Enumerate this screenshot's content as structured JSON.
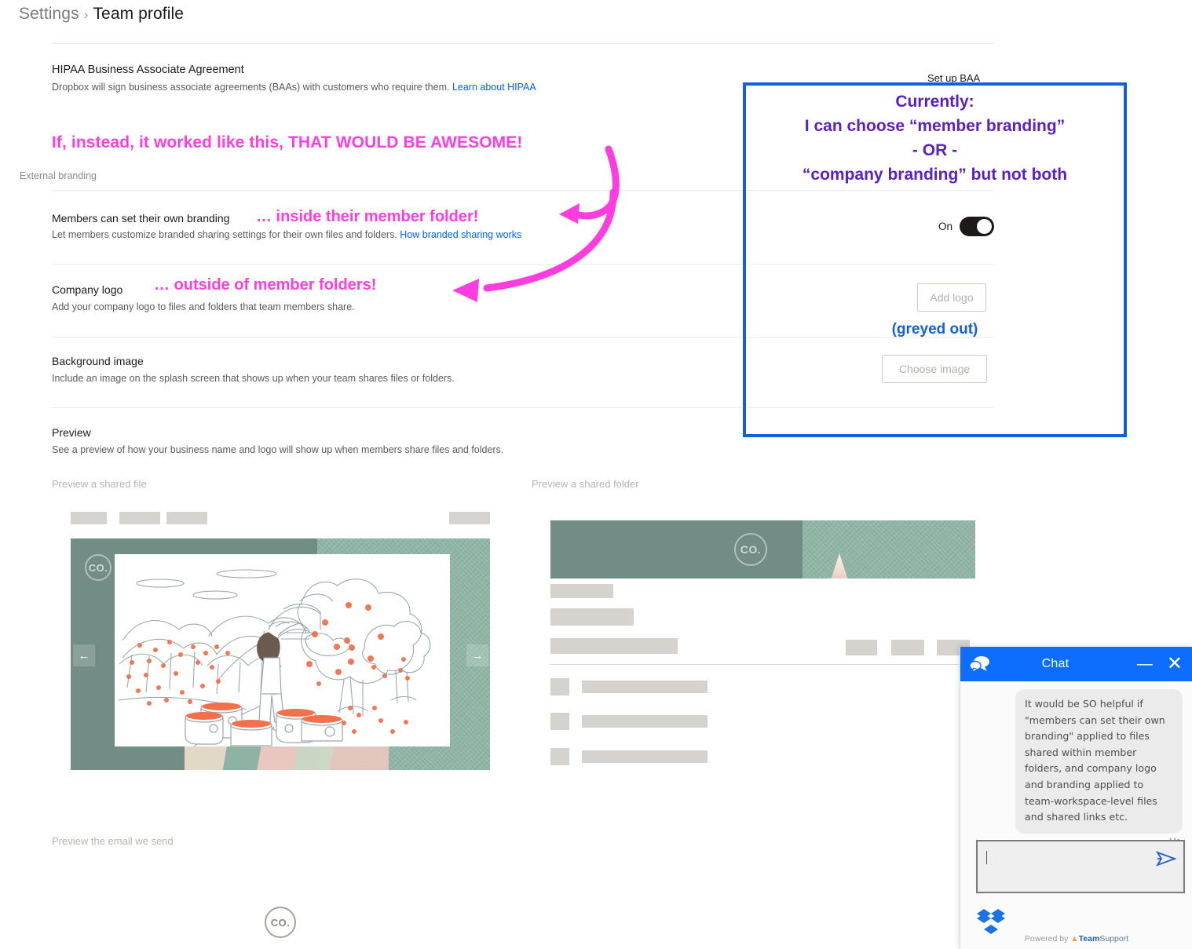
{
  "breadcrumb": {
    "parent": "Settings",
    "separator": "›",
    "current": "Team profile"
  },
  "hipaa": {
    "title": "HIPAA Business Associate Agreement",
    "description": "Dropbox will sign business associate agreements (BAAs) with customers who require them.",
    "link": "Learn about HIPAA",
    "action": "Set up BAA"
  },
  "annotations": {
    "pink_headline": "If, instead, it worked like this, THAT WOULD BE AWESOME!",
    "pink_inline_1": "… inside their member folder!",
    "pink_inline_2": "… outside of member folders!",
    "pink_color": "#ff3ce0",
    "blue_box": {
      "border_color": "#1161d8",
      "line1": "Currently:",
      "line2": "I can choose “member branding”",
      "line3": "- OR -",
      "line4": "“company branding” but not both",
      "text_color": "#5b20c2",
      "greyed_note": "(greyed out)",
      "greyed_note_color": "#1161d8"
    }
  },
  "external_branding": {
    "section_label": "External branding",
    "rows": [
      {
        "title": "Members can set their own branding",
        "description": "Let members customize branded sharing settings for their own files and folders.",
        "link": "How branded sharing works",
        "control": "toggle",
        "control_state": "On"
      },
      {
        "title": "Company logo",
        "description": "Add your company logo to files and folders that team members share.",
        "control": "button",
        "control_label": "Add logo"
      },
      {
        "title": "Background image",
        "description": "Include an image on the splash screen that shows up when your team shares files or folders.",
        "control": "button",
        "control_label": "Choose image"
      },
      {
        "title": "Preview",
        "description": "See a preview of how your business name and logo will show up when members share files and folders."
      }
    ]
  },
  "previews": {
    "file_caption": "Preview a shared file",
    "folder_caption": "Preview a shared folder",
    "email_caption": "Preview the email we send",
    "logo_text": "CO.",
    "nav_prev_icon": "arrow-left-icon",
    "nav_next_icon": "arrow-right-icon",
    "nav_prev_glyph": "←",
    "nav_next_glyph": "→"
  },
  "chat": {
    "title": "Chat",
    "minimize_glyph": "—",
    "close_glyph": "✕",
    "message": "It would be SO helpful if \"members can set their own branding\" applied to files shared within member folders, and company logo and branding applied to team-workspace-level files and shared links etc.",
    "message_author": "Me",
    "input_value": "",
    "input_placeholder": "",
    "powered_prefix": "Powered by",
    "powered_brand_a": "Team",
    "powered_brand_b": "Support",
    "header_color": "#0d6efd"
  }
}
